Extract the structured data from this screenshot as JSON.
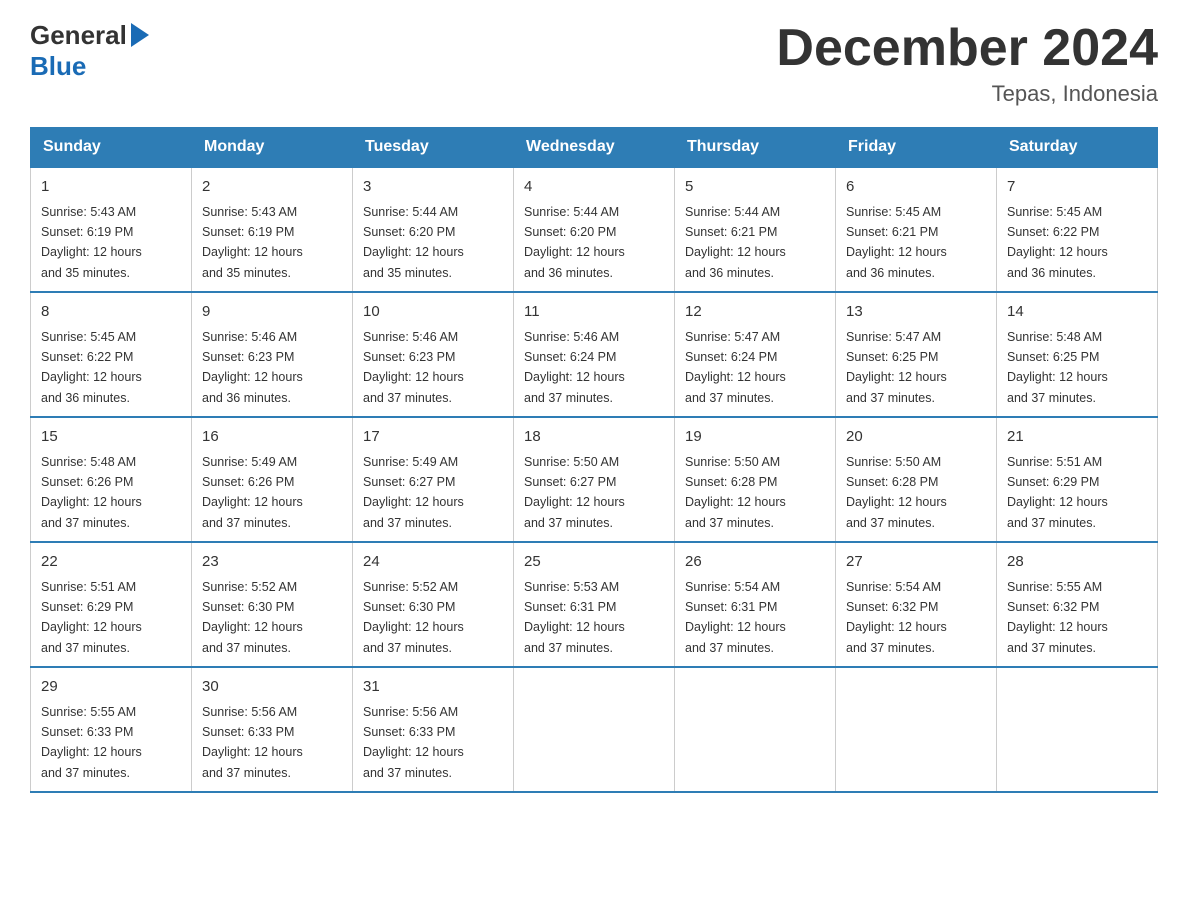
{
  "header": {
    "logo_general": "General",
    "logo_blue": "Blue",
    "month_title": "December 2024",
    "location": "Tepas, Indonesia"
  },
  "days_of_week": [
    "Sunday",
    "Monday",
    "Tuesday",
    "Wednesday",
    "Thursday",
    "Friday",
    "Saturday"
  ],
  "weeks": [
    [
      {
        "day": "1",
        "sunrise": "5:43 AM",
        "sunset": "6:19 PM",
        "daylight": "12 hours and 35 minutes."
      },
      {
        "day": "2",
        "sunrise": "5:43 AM",
        "sunset": "6:19 PM",
        "daylight": "12 hours and 35 minutes."
      },
      {
        "day": "3",
        "sunrise": "5:44 AM",
        "sunset": "6:20 PM",
        "daylight": "12 hours and 35 minutes."
      },
      {
        "day": "4",
        "sunrise": "5:44 AM",
        "sunset": "6:20 PM",
        "daylight": "12 hours and 36 minutes."
      },
      {
        "day": "5",
        "sunrise": "5:44 AM",
        "sunset": "6:21 PM",
        "daylight": "12 hours and 36 minutes."
      },
      {
        "day": "6",
        "sunrise": "5:45 AM",
        "sunset": "6:21 PM",
        "daylight": "12 hours and 36 minutes."
      },
      {
        "day": "7",
        "sunrise": "5:45 AM",
        "sunset": "6:22 PM",
        "daylight": "12 hours and 36 minutes."
      }
    ],
    [
      {
        "day": "8",
        "sunrise": "5:45 AM",
        "sunset": "6:22 PM",
        "daylight": "12 hours and 36 minutes."
      },
      {
        "day": "9",
        "sunrise": "5:46 AM",
        "sunset": "6:23 PM",
        "daylight": "12 hours and 36 minutes."
      },
      {
        "day": "10",
        "sunrise": "5:46 AM",
        "sunset": "6:23 PM",
        "daylight": "12 hours and 37 minutes."
      },
      {
        "day": "11",
        "sunrise": "5:46 AM",
        "sunset": "6:24 PM",
        "daylight": "12 hours and 37 minutes."
      },
      {
        "day": "12",
        "sunrise": "5:47 AM",
        "sunset": "6:24 PM",
        "daylight": "12 hours and 37 minutes."
      },
      {
        "day": "13",
        "sunrise": "5:47 AM",
        "sunset": "6:25 PM",
        "daylight": "12 hours and 37 minutes."
      },
      {
        "day": "14",
        "sunrise": "5:48 AM",
        "sunset": "6:25 PM",
        "daylight": "12 hours and 37 minutes."
      }
    ],
    [
      {
        "day": "15",
        "sunrise": "5:48 AM",
        "sunset": "6:26 PM",
        "daylight": "12 hours and 37 minutes."
      },
      {
        "day": "16",
        "sunrise": "5:49 AM",
        "sunset": "6:26 PM",
        "daylight": "12 hours and 37 minutes."
      },
      {
        "day": "17",
        "sunrise": "5:49 AM",
        "sunset": "6:27 PM",
        "daylight": "12 hours and 37 minutes."
      },
      {
        "day": "18",
        "sunrise": "5:50 AM",
        "sunset": "6:27 PM",
        "daylight": "12 hours and 37 minutes."
      },
      {
        "day": "19",
        "sunrise": "5:50 AM",
        "sunset": "6:28 PM",
        "daylight": "12 hours and 37 minutes."
      },
      {
        "day": "20",
        "sunrise": "5:50 AM",
        "sunset": "6:28 PM",
        "daylight": "12 hours and 37 minutes."
      },
      {
        "day": "21",
        "sunrise": "5:51 AM",
        "sunset": "6:29 PM",
        "daylight": "12 hours and 37 minutes."
      }
    ],
    [
      {
        "day": "22",
        "sunrise": "5:51 AM",
        "sunset": "6:29 PM",
        "daylight": "12 hours and 37 minutes."
      },
      {
        "day": "23",
        "sunrise": "5:52 AM",
        "sunset": "6:30 PM",
        "daylight": "12 hours and 37 minutes."
      },
      {
        "day": "24",
        "sunrise": "5:52 AM",
        "sunset": "6:30 PM",
        "daylight": "12 hours and 37 minutes."
      },
      {
        "day": "25",
        "sunrise": "5:53 AM",
        "sunset": "6:31 PM",
        "daylight": "12 hours and 37 minutes."
      },
      {
        "day": "26",
        "sunrise": "5:54 AM",
        "sunset": "6:31 PM",
        "daylight": "12 hours and 37 minutes."
      },
      {
        "day": "27",
        "sunrise": "5:54 AM",
        "sunset": "6:32 PM",
        "daylight": "12 hours and 37 minutes."
      },
      {
        "day": "28",
        "sunrise": "5:55 AM",
        "sunset": "6:32 PM",
        "daylight": "12 hours and 37 minutes."
      }
    ],
    [
      {
        "day": "29",
        "sunrise": "5:55 AM",
        "sunset": "6:33 PM",
        "daylight": "12 hours and 37 minutes."
      },
      {
        "day": "30",
        "sunrise": "5:56 AM",
        "sunset": "6:33 PM",
        "daylight": "12 hours and 37 minutes."
      },
      {
        "day": "31",
        "sunrise": "5:56 AM",
        "sunset": "6:33 PM",
        "daylight": "12 hours and 37 minutes."
      },
      null,
      null,
      null,
      null
    ]
  ],
  "labels": {
    "sunrise": "Sunrise:",
    "sunset": "Sunset:",
    "daylight": "Daylight:"
  }
}
